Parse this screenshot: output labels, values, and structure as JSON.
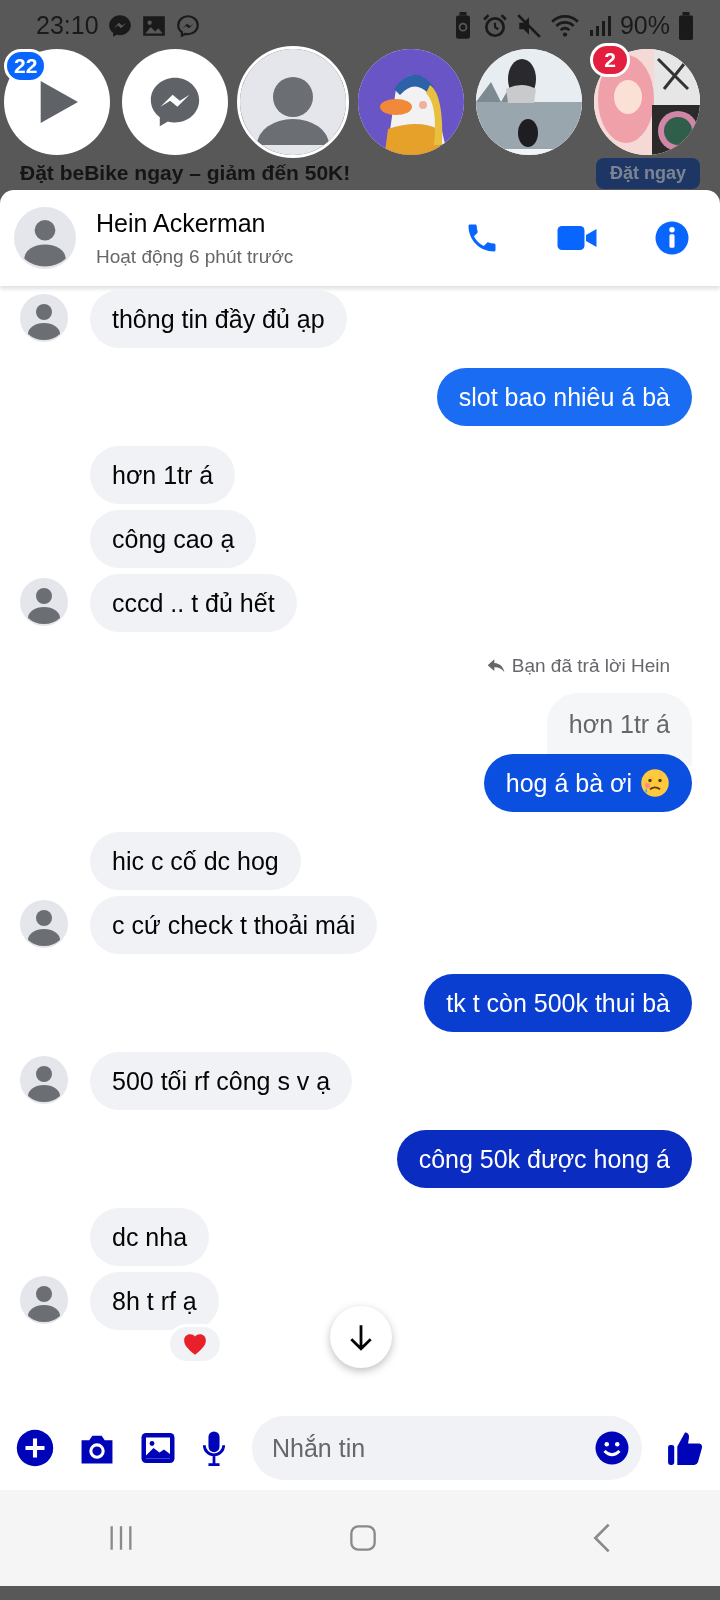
{
  "status_bar": {
    "time": "23:10",
    "battery": "90%"
  },
  "background_ad": {
    "headline": "Đặt beBike ngay – giảm đến 50K!",
    "button": "Đặt ngay"
  },
  "chat_heads": [
    {
      "kind": "video",
      "badge": "22",
      "selected": false
    },
    {
      "kind": "messenger",
      "selected": false
    },
    {
      "kind": "avatar",
      "selected": true
    },
    {
      "kind": "picture",
      "selected": false
    },
    {
      "kind": "picture",
      "selected": false
    },
    {
      "kind": "picture",
      "badge": "2",
      "selected": false
    }
  ],
  "conversation": {
    "name": "Hein Ackerman",
    "status": "Hoạt động 6 phút trước"
  },
  "messages": [
    {
      "kind": "received",
      "text": "thông tin đầy đủ ạp"
    },
    {
      "kind": "sent",
      "text": "slot bao nhiêu á bà"
    },
    {
      "kind": "received",
      "text": "hơn 1tr á"
    },
    {
      "kind": "received",
      "text": "công cao ạ"
    },
    {
      "kind": "received",
      "text": "cccd .. t đủ hết"
    },
    {
      "kind": "reply_note",
      "text": "Bạn đã trả lời Hein"
    },
    {
      "kind": "quoted",
      "text": "hơn 1tr á"
    },
    {
      "kind": "sent",
      "text": "hog á bà ơi",
      "emoji": true
    },
    {
      "kind": "received",
      "text": "hic c cố dc hog"
    },
    {
      "kind": "received",
      "text": "c cứ check t thoải mái"
    },
    {
      "kind": "sent",
      "text": "tk t còn 500k thui bà"
    },
    {
      "kind": "received",
      "text": "500 tối rf công s v ạ"
    },
    {
      "kind": "sent",
      "text": "công 50k được hong á"
    },
    {
      "kind": "received",
      "text": "dc nha"
    },
    {
      "kind": "received",
      "text": "8h t rf ạ",
      "reaction": true
    }
  ],
  "composer": {
    "placeholder": "Nhắn tin"
  }
}
